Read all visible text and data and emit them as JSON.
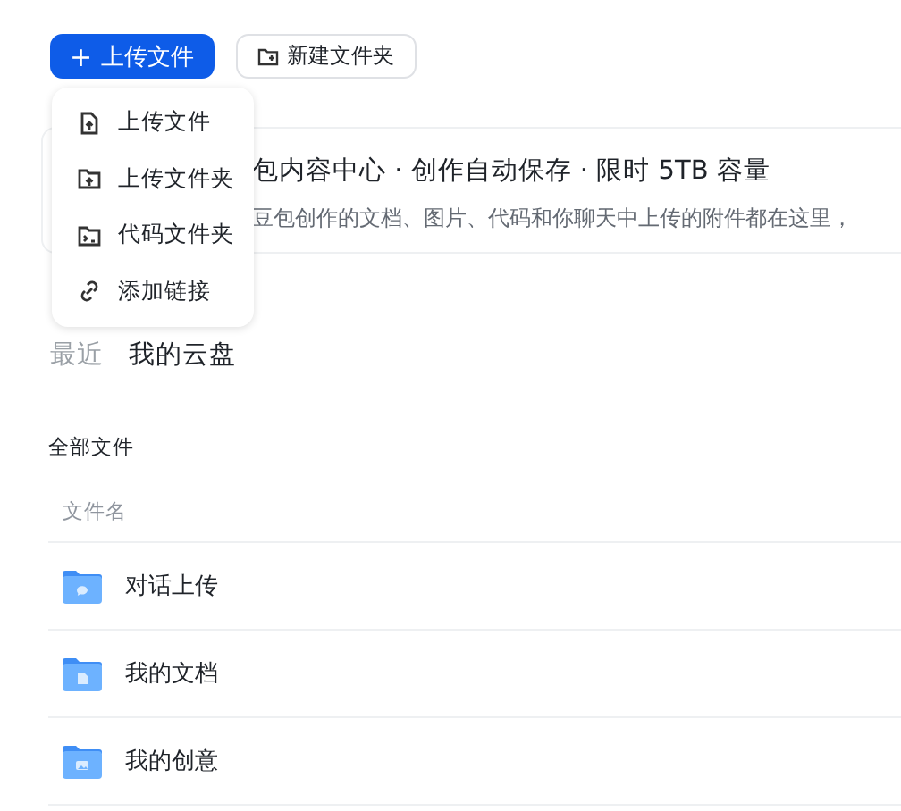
{
  "toolbar": {
    "upload_button": {
      "icon": "+",
      "label": "上传文件"
    },
    "new_folder_button": {
      "label": "新建文件夹"
    }
  },
  "upload_menu": [
    {
      "kind": "file",
      "label": "上传文件"
    },
    {
      "kind": "folder",
      "label": "上传文件夹"
    },
    {
      "kind": "code",
      "label": "代码文件夹"
    },
    {
      "kind": "link",
      "label": "添加链接"
    }
  ],
  "banner": {
    "title": "包内容中心 · 创作自动保存 · 限时 5TB 容量",
    "subtitle": "豆包创作的文档、图片、代码和你聊天中上传的附件都在这里，"
  },
  "tabs": [
    {
      "label": "最近",
      "selected": false
    },
    {
      "label": "我的云盘",
      "selected": true
    }
  ],
  "section_title": "全部文件",
  "table": {
    "columns": [
      "文件名"
    ],
    "rows": [
      {
        "kind": "chat",
        "name": "对话上传"
      },
      {
        "kind": "doc",
        "name": "我的文档"
      },
      {
        "kind": "image",
        "name": "我的创意"
      }
    ]
  }
}
